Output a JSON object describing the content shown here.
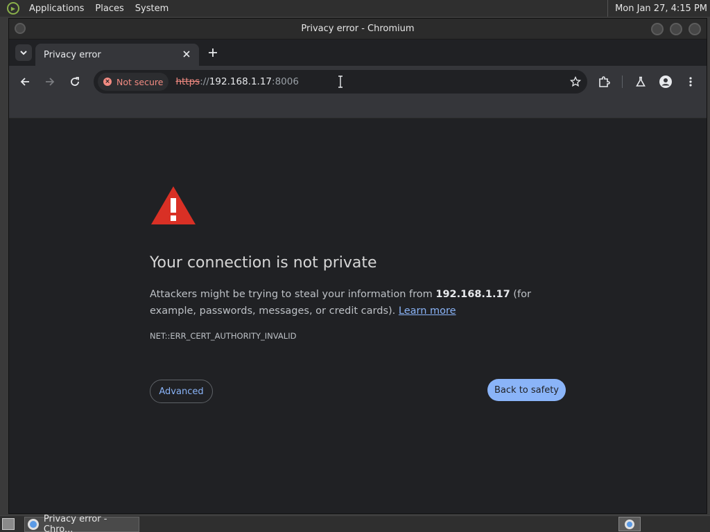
{
  "top_panel": {
    "menus": [
      "Applications",
      "Places",
      "System"
    ],
    "clock": "Mon Jan 27,  4:15 PM"
  },
  "window": {
    "title": "Privacy error - Chromium"
  },
  "tabs": [
    {
      "label": "Privacy error"
    }
  ],
  "toolbar": {
    "security_chip": "Not secure",
    "url_scheme": "https",
    "url_sep": "://",
    "url_host": "192.168.1.17",
    "url_port": ":8006"
  },
  "page": {
    "heading": "Your connection is not private",
    "body_prefix": "Attackers might be trying to steal your information from ",
    "body_host": "192.168.1.17",
    "body_suffix": " (for example, passwords, messages, or credit cards). ",
    "learn_more": "Learn more",
    "error_code": "NET::ERR_CERT_AUTHORITY_INVALID",
    "advanced_label": "Advanced",
    "back_label": "Back to safety"
  },
  "taskbar": {
    "task_label": "Privacy error - Chro..."
  },
  "colors": {
    "accent": "#8ab4f8",
    "warning": "#d93025",
    "not_secure": "#f28b82"
  }
}
